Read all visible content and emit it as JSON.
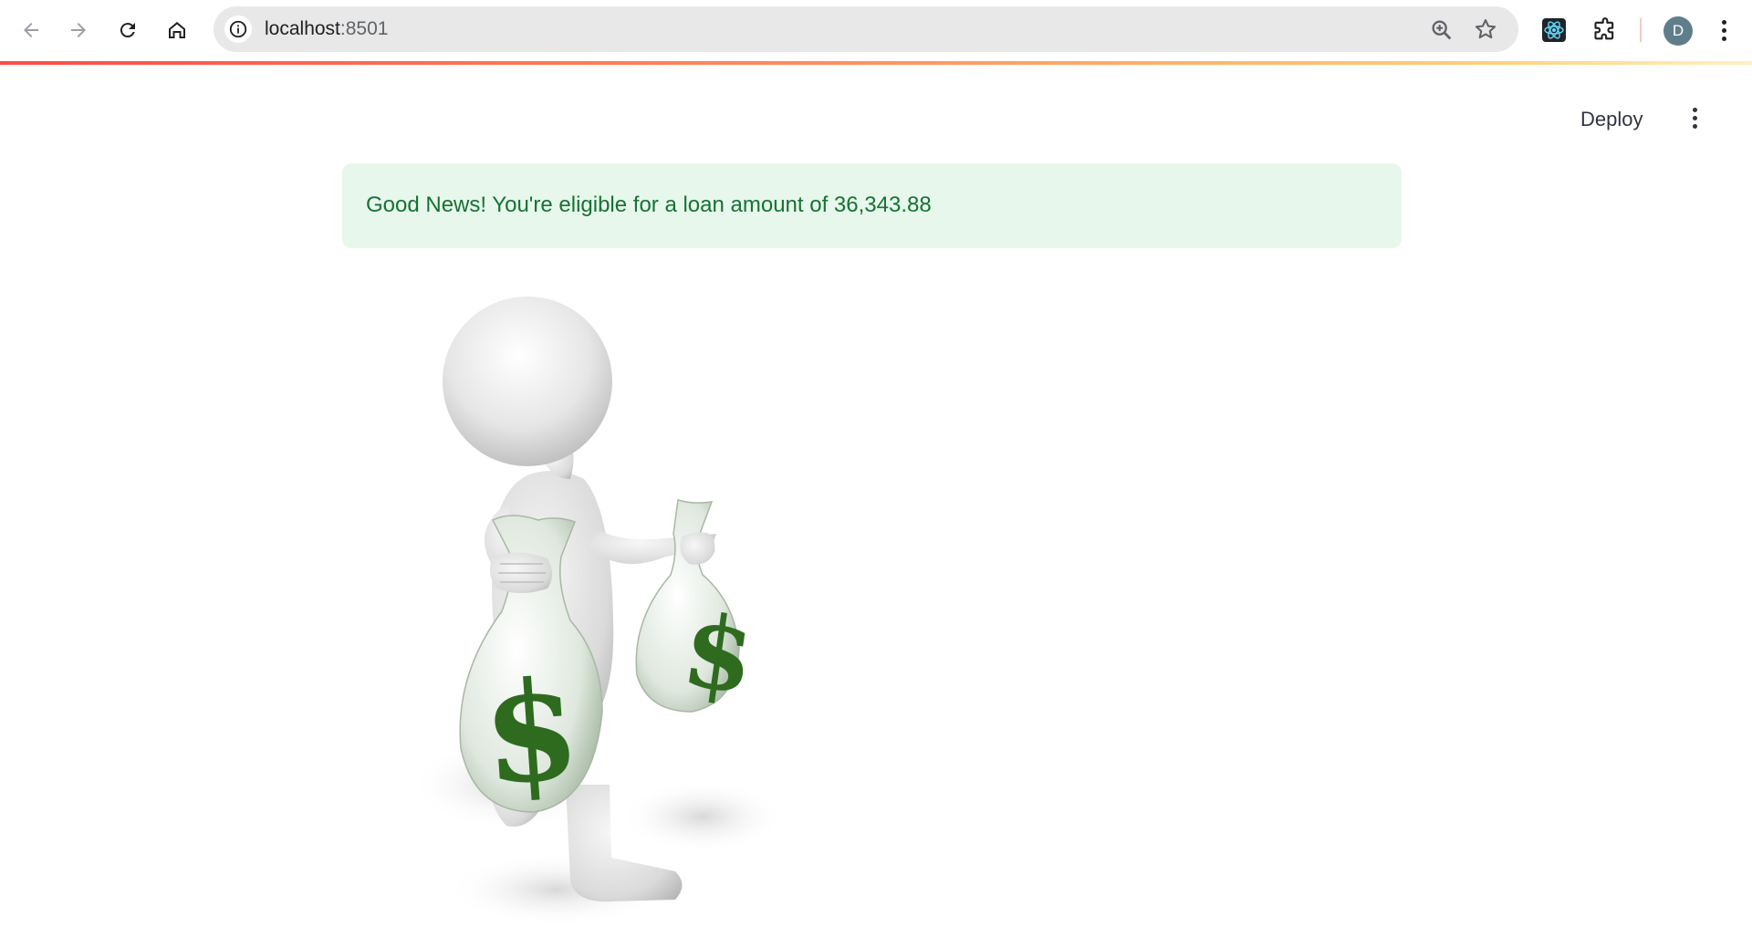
{
  "browser": {
    "url_host": "localhost",
    "url_port": ":8501",
    "profile_initial": "D",
    "icons": [
      "back-arrow-icon",
      "forward-arrow-icon",
      "reload-icon",
      "home-icon",
      "info-icon",
      "zoom-icon",
      "star-icon",
      "react-devtools-icon",
      "puzzle-icon",
      "more-vert-icon"
    ]
  },
  "app": {
    "deploy_label": "Deploy",
    "alert_message": "Good News! You're eligible for a loan amount of 36,343.88"
  },
  "colors": {
    "alert_bg": "#e7f7ec",
    "alert_text": "#177233",
    "dollar_green": "#2e6b1f",
    "accent_red": "#ff4b4b"
  }
}
